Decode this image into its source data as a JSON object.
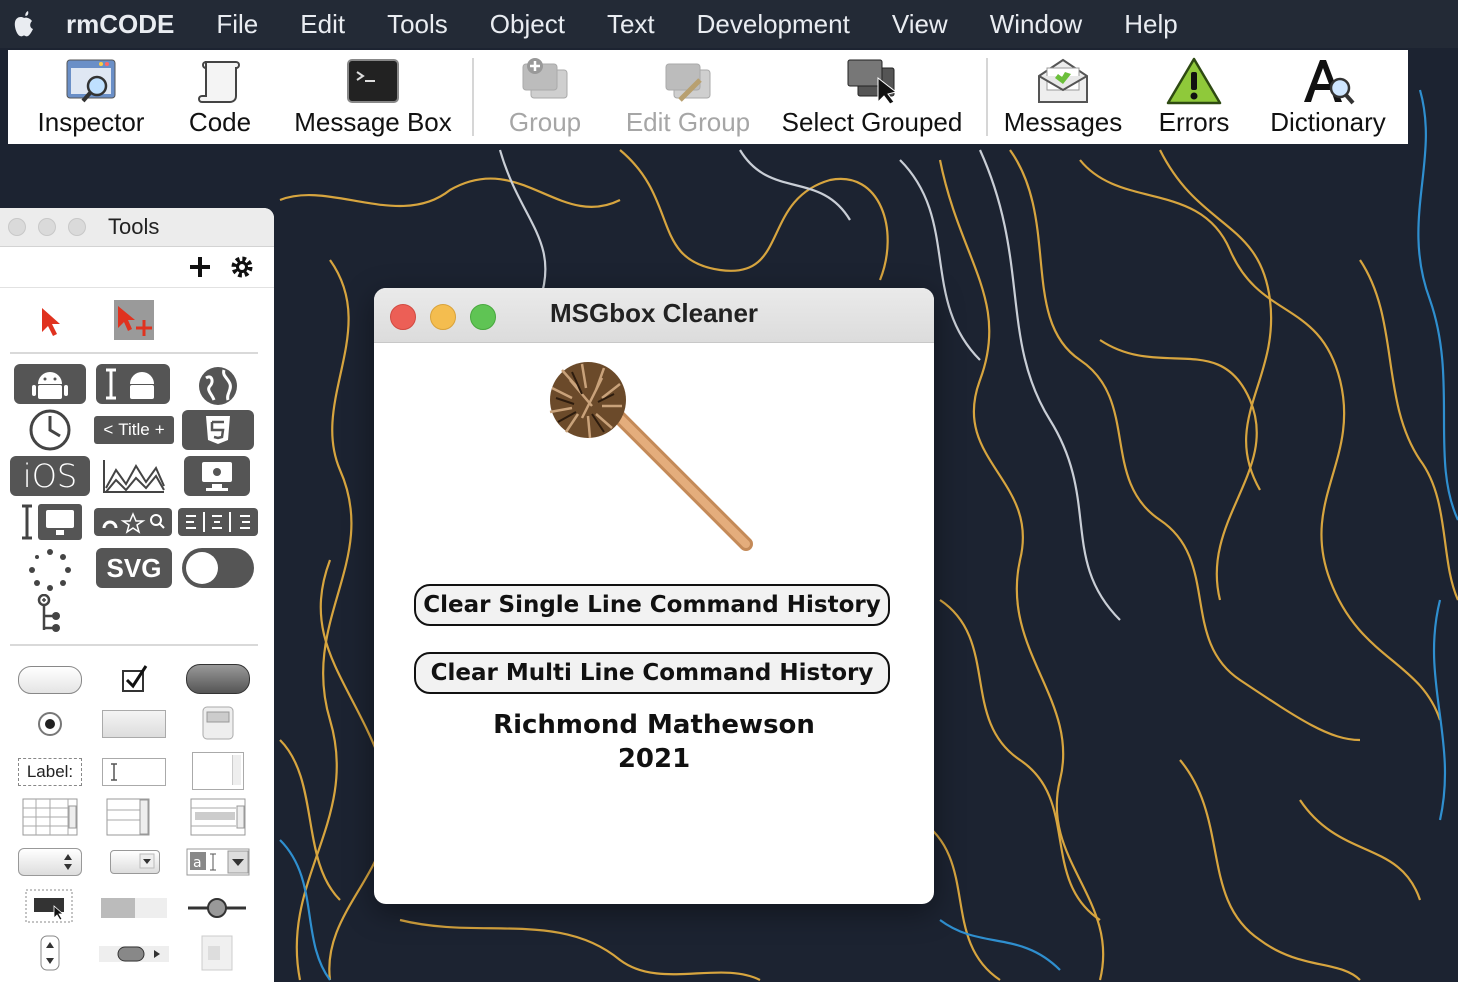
{
  "menubar": {
    "app_name": "rmCODE",
    "items": [
      "File",
      "Edit",
      "Tools",
      "Object",
      "Text",
      "Development",
      "View",
      "Window",
      "Help"
    ]
  },
  "toolbar": {
    "items": [
      {
        "label": "Inspector",
        "icon": "inspector-icon",
        "enabled": true
      },
      {
        "label": "Code",
        "icon": "scroll-icon",
        "enabled": true
      },
      {
        "label": "Message Box",
        "icon": "terminal-icon",
        "enabled": true
      },
      {
        "label": "Group",
        "icon": "group-icon",
        "enabled": false
      },
      {
        "label": "Edit Group",
        "icon": "edit-group-icon",
        "enabled": false
      },
      {
        "label": "Select Grouped",
        "icon": "select-grouped-icon",
        "enabled": true
      },
      {
        "label": "Messages",
        "icon": "envelope-icon",
        "enabled": true
      },
      {
        "label": "Errors",
        "icon": "warning-icon",
        "enabled": true
      },
      {
        "label": "Dictionary",
        "icon": "dictionary-icon",
        "enabled": true
      }
    ]
  },
  "tools_palette": {
    "title": "Tools",
    "widget_labels": {
      "title_bar": "Title",
      "svg": "SVG",
      "ios": "iOS",
      "label": "Label:"
    }
  },
  "msg_window": {
    "title": "MSGbox Cleaner",
    "button_single": "Clear Single Line Command History",
    "button_multi": "Clear Multi Line Command History",
    "author": "Richmond Mathewson",
    "year": "2021"
  },
  "colors": {
    "menubar_bg": "#232a36",
    "desktop_bg": "#1c2331",
    "contour_gold": "#d7a53f",
    "contour_blue": "#2f8fcf",
    "contour_white": "#c9ced6",
    "close": "#ec5f56",
    "minimize": "#f4bd4f",
    "zoom": "#5fc454"
  }
}
